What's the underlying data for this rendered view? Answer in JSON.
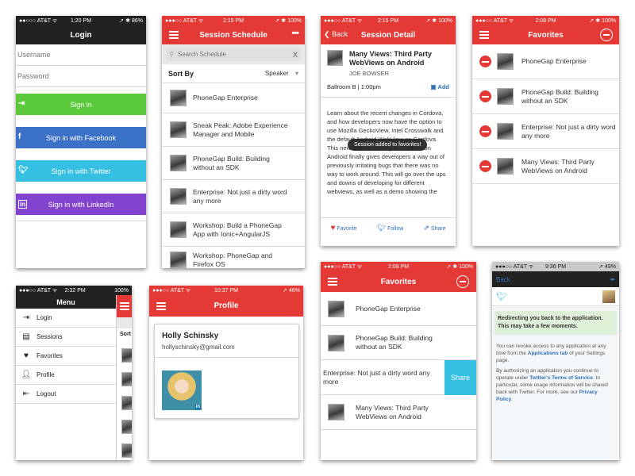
{
  "login": {
    "status": {
      "left": "●●○○○ AT&T ᯤ",
      "time": "1:20 PM",
      "right": "➚ ✱ 86%"
    },
    "title": "Login",
    "username_placeholder": "Username",
    "password_placeholder": "Password",
    "signin": "Sign in",
    "facebook": "Sign in with Facebook",
    "twitter": "Sign in with Twitter",
    "linkedin": "Sign in with LinkedIn",
    "colors": {
      "signin": "#5ac93a",
      "facebook": "#3b72c8",
      "twitter": "#35bfe3",
      "linkedin": "#8243cf"
    }
  },
  "schedule": {
    "status": {
      "left": "●●●○○ AT&T ᯤ",
      "time": "2:15 PM",
      "right": "➚ ✱ 100%"
    },
    "title": "Session Schedule",
    "search_placeholder": "Search Schedule",
    "sort_label": "Sort By",
    "sort_value": "Speaker",
    "items": [
      "PhoneGap Enterprise",
      "Sneak Peak: Adobe Experience Manager and Mobile",
      "PhoneGap Build: Building without an SDK",
      "Enterprise: Not just a dirty word any more",
      "Workshop: Build a PhoneGap App with Ionic+AngularJS",
      "Workshop: PhoneGap and Firefox OS"
    ]
  },
  "detail": {
    "status": {
      "left": "●●●○○ AT&T ᯤ",
      "time": "2:15 PM",
      "right": "➚ ✱ 100%"
    },
    "back": "Back",
    "title": "Session Detail",
    "session_title": "Many Views: Third Party WebViews on Android",
    "speaker": "JOE BOWSER",
    "location": "Ballroom B | 1:00pm",
    "add": "Add",
    "description": "Learn about the recent changes in Cordova, and how developers now have the option to use Mozilla GeckoView, Intel Crosswalk and the default Android WebView on Cordova. This new feature coming to Cordova on Android finally gives developers a way out of previously irritating bugs that there was no way to work around. This will go over the ups and downs of developing for different webviews, as well as a demo showing the power of this new feature.",
    "toast": "Session added to favorites!",
    "favorite": "Favorite",
    "follow": "Follow",
    "share": "Share"
  },
  "favorites_edit": {
    "status": {
      "left": "●●●○○ AT&T ᯤ",
      "time": "2:08 PM",
      "right": "➚ ✱ 100%"
    },
    "title": "Favorites",
    "items": [
      "PhoneGap Enterprise",
      "PhoneGap Build: Building without an SDK",
      "Enterprise: Not just a dirty word any more",
      "Many Views: Third Party WebViews on Android"
    ]
  },
  "menu": {
    "status": {
      "left": "●●●○○ AT&T ᯤ",
      "time": "2:32 PM",
      "right": "100%"
    },
    "title": "Menu",
    "items": [
      "Login",
      "Sessions",
      "Favorites",
      "Profile",
      "Logout"
    ],
    "behind_label": "Sort"
  },
  "profile": {
    "status": {
      "left": "●●●○○ AT&T ᯤ",
      "time": "10:37 PM",
      "right": "➚ 46%"
    },
    "title": "Profile",
    "name": "Holly Schinsky",
    "email": "hollyschinsky@gmail.com",
    "badge": "in"
  },
  "favorites_swipe": {
    "status": {
      "left": "●●●○○ AT&T ᯤ",
      "time": "2:08 PM",
      "right": "➚ ✱ 100%"
    },
    "title": "Favorites",
    "items": [
      "PhoneGap Enterprise",
      "PhoneGap Build: Building without an SDK",
      "Enterprise: Not just a dirty word any more",
      "Many Views: Third Party WebViews on Android"
    ],
    "share": "Share"
  },
  "twitter_redirect": {
    "status": {
      "left": "●●●○○ AT&T ᯤ",
      "time": "9:36 PM",
      "right": "➚ 49%"
    },
    "back": "Back",
    "redirect_message": "Redirecting you back to the application. This may take a few moments.",
    "revoke_pre": "You can revoke access to any application at any time from the",
    "revoke_link": "Applications tab",
    "revoke_post": "of your Settings page.",
    "authorize_pre": "By authorizing an application you continue to operate under",
    "tos_link": "Twitter's Terms of Service",
    "authorize_post": ". In particular, some usage information will be shared back with Twitter. For more, see our",
    "privacy_link": "Privacy Policy",
    "period": "."
  }
}
